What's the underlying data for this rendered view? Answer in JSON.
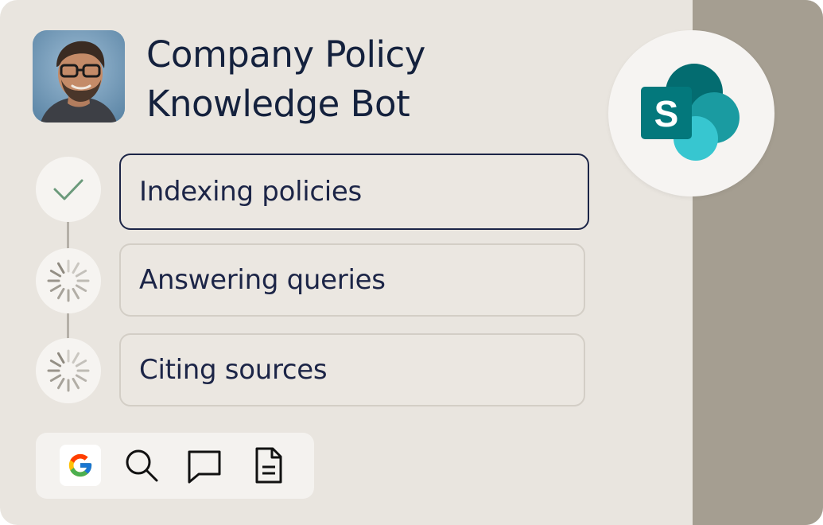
{
  "header": {
    "title_line1": "Company Policy",
    "title_line2": "Knowledge Bot"
  },
  "integration": {
    "logo_letter": "S",
    "icon": "sharepoint-logo",
    "colors": [
      "#036c70",
      "#1a9ba1",
      "#37c6d0",
      "#03787c"
    ]
  },
  "steps": [
    {
      "label": "Indexing policies",
      "status": "done",
      "icon": "check-icon"
    },
    {
      "label": "Answering queries",
      "status": "loading",
      "icon": "spinner-icon"
    },
    {
      "label": "Citing sources",
      "status": "loading",
      "icon": "spinner-icon"
    }
  ],
  "tools": [
    {
      "icon": "google-icon"
    },
    {
      "icon": "search-icon"
    },
    {
      "icon": "chat-bubble-icon"
    },
    {
      "icon": "document-icon"
    }
  ],
  "colors": {
    "card_bg": "#e9e5df",
    "side_panel": "#a59e91",
    "text": "#14213d",
    "check": "#6b9a7b",
    "active_border": "#1c2547"
  }
}
